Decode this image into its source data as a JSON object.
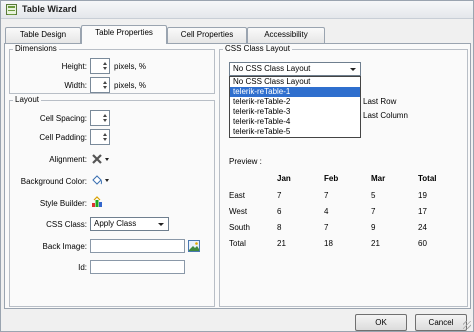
{
  "window": {
    "title": "Table Wizard"
  },
  "tabs": [
    {
      "label": "Table Design",
      "active": false
    },
    {
      "label": "Table Properties",
      "active": true
    },
    {
      "label": "Cell Properties",
      "active": false
    },
    {
      "label": "Accessibility",
      "active": false
    }
  ],
  "dimensions": {
    "title": "Dimensions",
    "height_label": "Height:",
    "height_value": "",
    "height_unit": "pixels, %",
    "width_label": "Width:",
    "width_value": "",
    "width_unit": "pixels, %"
  },
  "layout": {
    "title": "Layout",
    "cell_spacing_label": "Cell Spacing:",
    "cell_padding_label": "Cell Padding:",
    "alignment_label": "Alignment:",
    "background_color_label": "Background Color:",
    "style_builder_label": "Style Builder:",
    "css_class_label": "CSS Class:",
    "css_class_value": "Apply Class",
    "back_image_label": "Back Image:",
    "id_label": "Id:",
    "alignment_icon": "no-alignment-icon",
    "background_icon": "paint-bucket-icon",
    "style_builder_icon": "style-builder-icon",
    "back_image_icon": "image-browse-icon"
  },
  "css_class_layout": {
    "title": "CSS Class Layout",
    "selected": "No CSS Class Layout",
    "options": [
      "No CSS Class Layout",
      "telerik-reTable-1",
      "telerik-reTable-2",
      "telerik-reTable-3",
      "telerik-reTable-4",
      "telerik-reTable-5"
    ],
    "highlighted_index": 1,
    "last_row_label": "Last Row",
    "last_column_label": "Last Column"
  },
  "preview": {
    "label": "Preview :",
    "headers": [
      "",
      "Jan",
      "Feb",
      "Mar",
      "Total"
    ],
    "rows": [
      [
        "East",
        "7",
        "7",
        "5",
        "19"
      ],
      [
        "West",
        "6",
        "4",
        "7",
        "17"
      ],
      [
        "South",
        "8",
        "7",
        "9",
        "24"
      ],
      [
        "Total",
        "21",
        "18",
        "21",
        "60"
      ]
    ]
  },
  "buttons": {
    "ok": "OK",
    "cancel": "Cancel"
  },
  "colors": {
    "selection": "#2f6fce",
    "window_bg": "#f0f0f0",
    "panel_bg": "#fafafa"
  }
}
